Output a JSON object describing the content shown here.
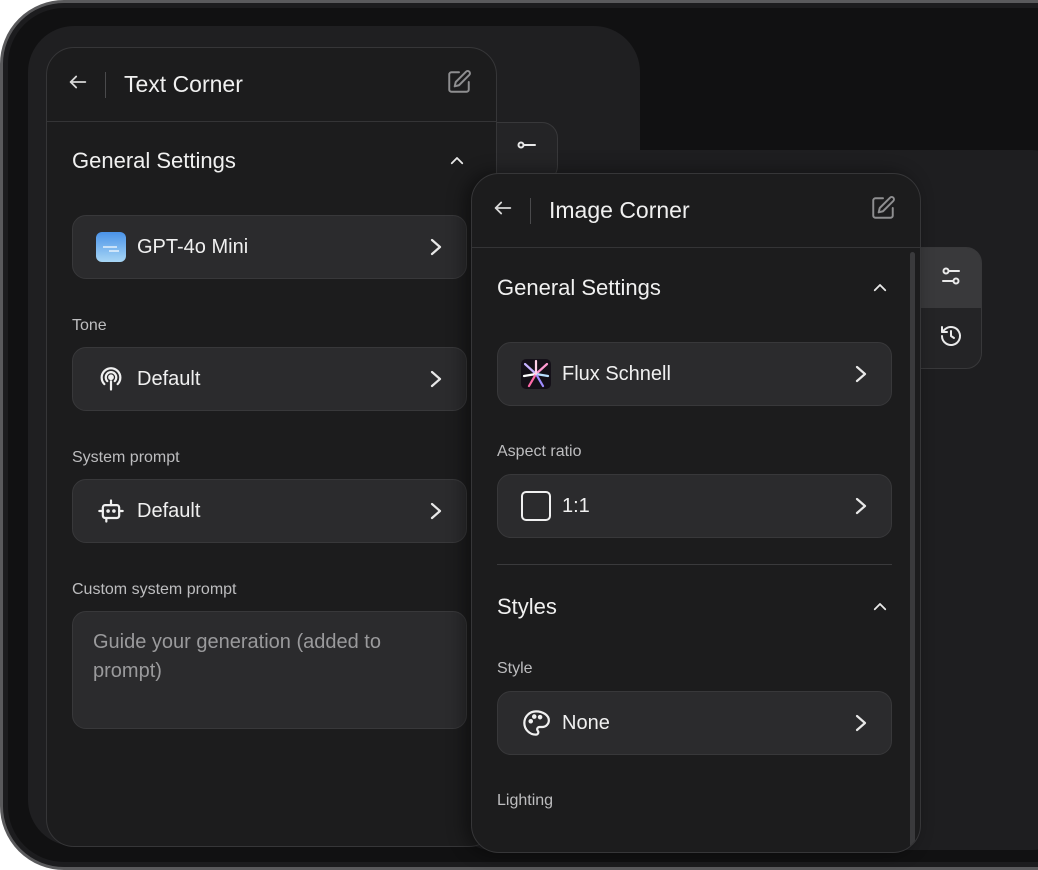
{
  "text_panel": {
    "title": "Text Corner",
    "section_title": "General Settings",
    "model": {
      "label": "GPT-4o Mini"
    },
    "tone": {
      "label": "Tone",
      "value": "Default"
    },
    "system_prompt": {
      "label": "System prompt",
      "value": "Default"
    },
    "custom_prompt": {
      "label": "Custom system prompt",
      "placeholder": "Guide your generation (added to prompt)"
    }
  },
  "image_panel": {
    "title": "Image Corner",
    "general_section_title": "General Settings",
    "model": {
      "label": "Flux Schnell"
    },
    "aspect_ratio": {
      "label": "Aspect ratio",
      "value": "1:1"
    },
    "styles_section_title": "Styles",
    "style": {
      "label": "Style",
      "value": "None"
    },
    "lighting": {
      "label": "Lighting"
    }
  },
  "toolstrip": {
    "icons": [
      "sliders-icon",
      "history-icon"
    ]
  },
  "colors": {
    "background": "#111112",
    "panel": "#1c1c1d",
    "field": "#2b2b2d",
    "text": "#f0f0f0",
    "muted": "#bdbdbf"
  }
}
